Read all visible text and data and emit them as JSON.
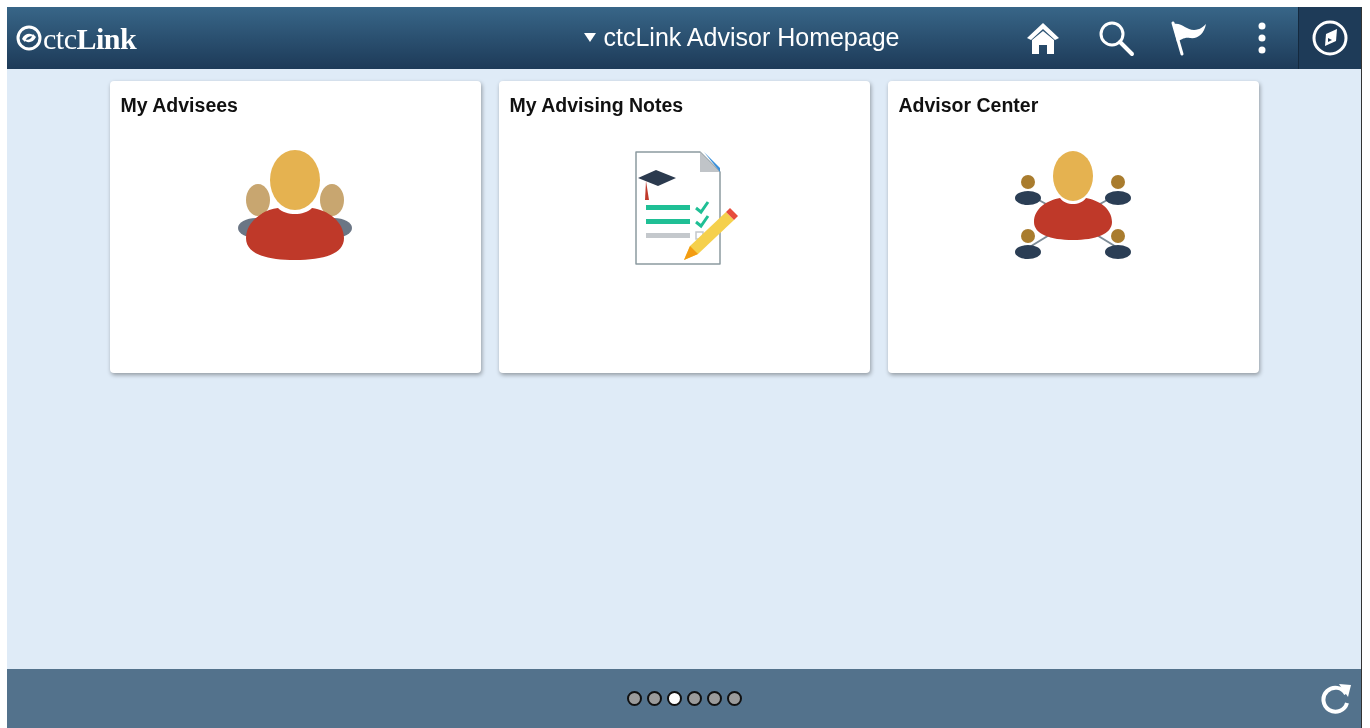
{
  "header": {
    "logo": "ctc**Link**",
    "title": "ctcLink Advisor Homepage"
  },
  "tiles": [
    {
      "title": "My Advisees",
      "kind": "group"
    },
    {
      "title": "My Advising Notes",
      "kind": "notes"
    },
    {
      "title": "Advisor Center",
      "kind": "network"
    }
  ],
  "pages": [
    {
      "selected": false
    },
    {
      "selected": false
    },
    {
      "selected": true
    },
    {
      "selected": false
    },
    {
      "selected": false
    },
    {
      "selected": false
    }
  ]
}
